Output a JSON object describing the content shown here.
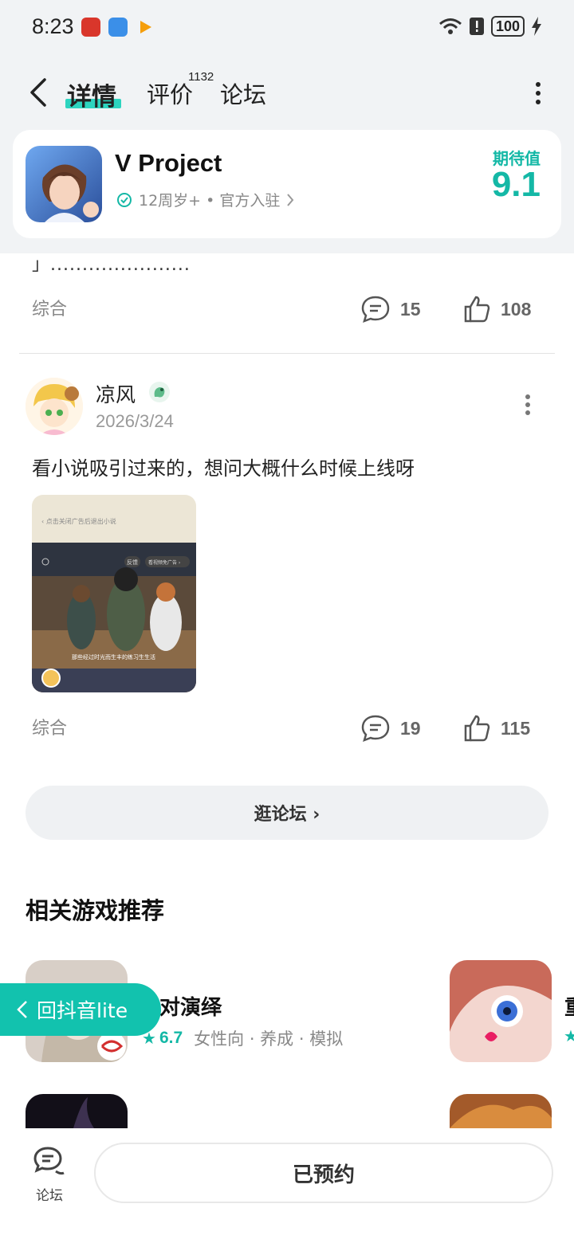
{
  "status_bar": {
    "time": "8:23",
    "battery": "100"
  },
  "header": {
    "tabs": [
      {
        "label": "详情",
        "active": true
      },
      {
        "label": "评价",
        "count": "1132"
      },
      {
        "label": "论坛"
      }
    ]
  },
  "app": {
    "name": "V Project",
    "meta": "12周岁+ • 官方入驻",
    "expect_label": "期待值",
    "expect_value": "9.1"
  },
  "posts": [
    {
      "truncated_text": "」......................",
      "tag": "综合",
      "comments": "15",
      "likes": "108"
    },
    {
      "user": "凉风",
      "date": "2026/3/24",
      "body": "看小说吸引过来的，想问大概什么时候上线呀",
      "image_text": {
        "top": "‹ 点击关闭广告后退出小说",
        "feedback": "反馈",
        "skip": "看视频免广告 ›",
        "subtitle": "那些经过时光而生丰的练习生生活"
      },
      "tag": "综合",
      "comments": "19",
      "likes": "115"
    }
  ],
  "forum_button": "逛论坛 ›",
  "recommend": {
    "title": "相关游戏推荐",
    "items": [
      {
        "name": "对演绎",
        "score": "6.7",
        "tags": "女性向 · 养成 · 模拟"
      },
      {
        "name": "重",
        "score": ""
      }
    ]
  },
  "back_pill": "回抖音lite",
  "bottom": {
    "forum_label": "论坛",
    "reserve_label": "已预约"
  },
  "colors": {
    "accent": "#14b8a6",
    "pill": "#12c2ae"
  }
}
